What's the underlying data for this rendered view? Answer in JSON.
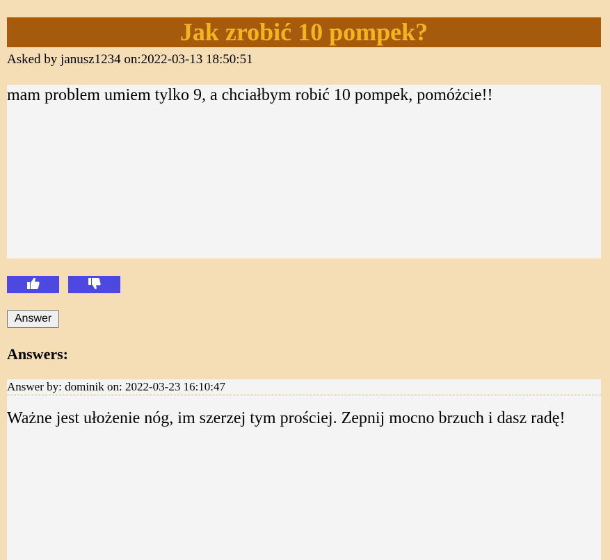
{
  "question": {
    "title": "Jak zrobić 10 pompek?",
    "asked_by": "Asked by janusz1234 on:2022-03-13 18:50:51",
    "body": "mam problem umiem tylko 9, a chciałbym robić 10 pompek, pomóżcie!!"
  },
  "votes": {
    "up_icon": "thumbs-up-icon",
    "down_icon": "thumbs-down-icon"
  },
  "actions": {
    "answer_label": "Answer"
  },
  "answers": {
    "heading": "Answers:",
    "items": [
      {
        "meta": "Answer by: dominik on: 2022-03-23 16:10:47",
        "text": "Ważne jest ułożenie nóg, im szerzej tym prościej. Zepnij mocno brzuch i dasz radę!"
      }
    ]
  },
  "colors": {
    "page_background": "#f5deb5",
    "title_background": "#a65a0c",
    "title_text": "#f2b520",
    "vote_button": "#4c48e0",
    "content_background": "#f4f4f4"
  }
}
